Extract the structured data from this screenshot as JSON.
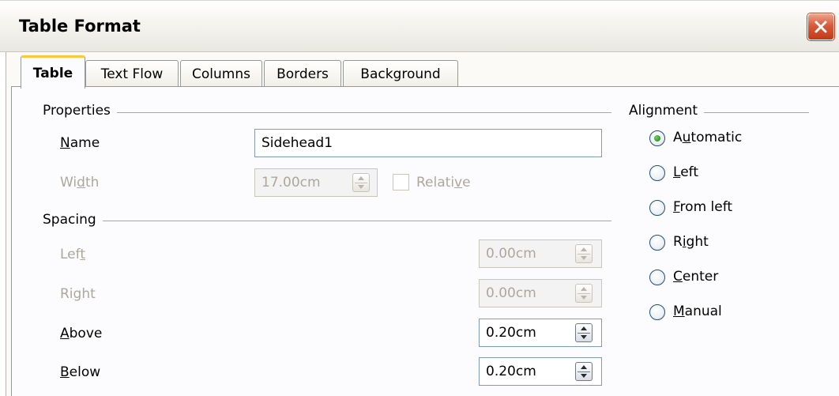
{
  "window": {
    "title": "Table Format"
  },
  "tabs": [
    {
      "label": "Table",
      "active": true
    },
    {
      "label": "Text Flow",
      "active": false
    },
    {
      "label": "Columns",
      "active": false
    },
    {
      "label": "Borders",
      "active": false
    },
    {
      "label": "Background",
      "active": false
    }
  ],
  "properties": {
    "group_label": "Properties",
    "name": {
      "label_pre": "",
      "label_key": "N",
      "label_post": "ame",
      "value": "Sidehead1"
    },
    "width": {
      "label_pre": "Wi",
      "label_key": "d",
      "label_post": "th",
      "value": "17.00cm",
      "enabled": false
    },
    "relative": {
      "label_pre": "Relati",
      "label_key": "v",
      "label_post": "e",
      "checked": false,
      "enabled": false
    }
  },
  "spacing": {
    "group_label": "Spacing",
    "left": {
      "label_pre": "Lef",
      "label_key": "t",
      "label_post": "",
      "value": "0.00cm",
      "enabled": false
    },
    "right": {
      "label_pre": "Ri",
      "label_key": "g",
      "label_post": "ht",
      "value": "0.00cm",
      "enabled": false
    },
    "above": {
      "label_pre": "",
      "label_key": "A",
      "label_post": "bove",
      "value": "0.20cm",
      "enabled": true
    },
    "below": {
      "label_pre": "",
      "label_key": "B",
      "label_post": "elow",
      "value": "0.20cm",
      "enabled": true
    }
  },
  "alignment": {
    "group_label": "Alignment",
    "options": [
      {
        "label_pre": "A",
        "label_key": "u",
        "label_post": "tomatic",
        "checked": true
      },
      {
        "label_pre": "",
        "label_key": "L",
        "label_post": "eft",
        "checked": false
      },
      {
        "label_pre": "",
        "label_key": "F",
        "label_post": "rom left",
        "checked": false
      },
      {
        "label_pre": "R",
        "label_key": "i",
        "label_post": "ght",
        "checked": false
      },
      {
        "label_pre": "",
        "label_key": "C",
        "label_post": "enter",
        "checked": false
      },
      {
        "label_pre": "",
        "label_key": "M",
        "label_post": "anual",
        "checked": false
      }
    ]
  },
  "colors": {
    "tab_accent": "#ffc83c",
    "close_button": "#d9593a",
    "radio_dot": "#2c9a25",
    "disabled_text": "#aca899"
  },
  "icons": {
    "close": "close-icon",
    "spin_up": "arrow-up-icon",
    "spin_down": "arrow-down-icon"
  }
}
